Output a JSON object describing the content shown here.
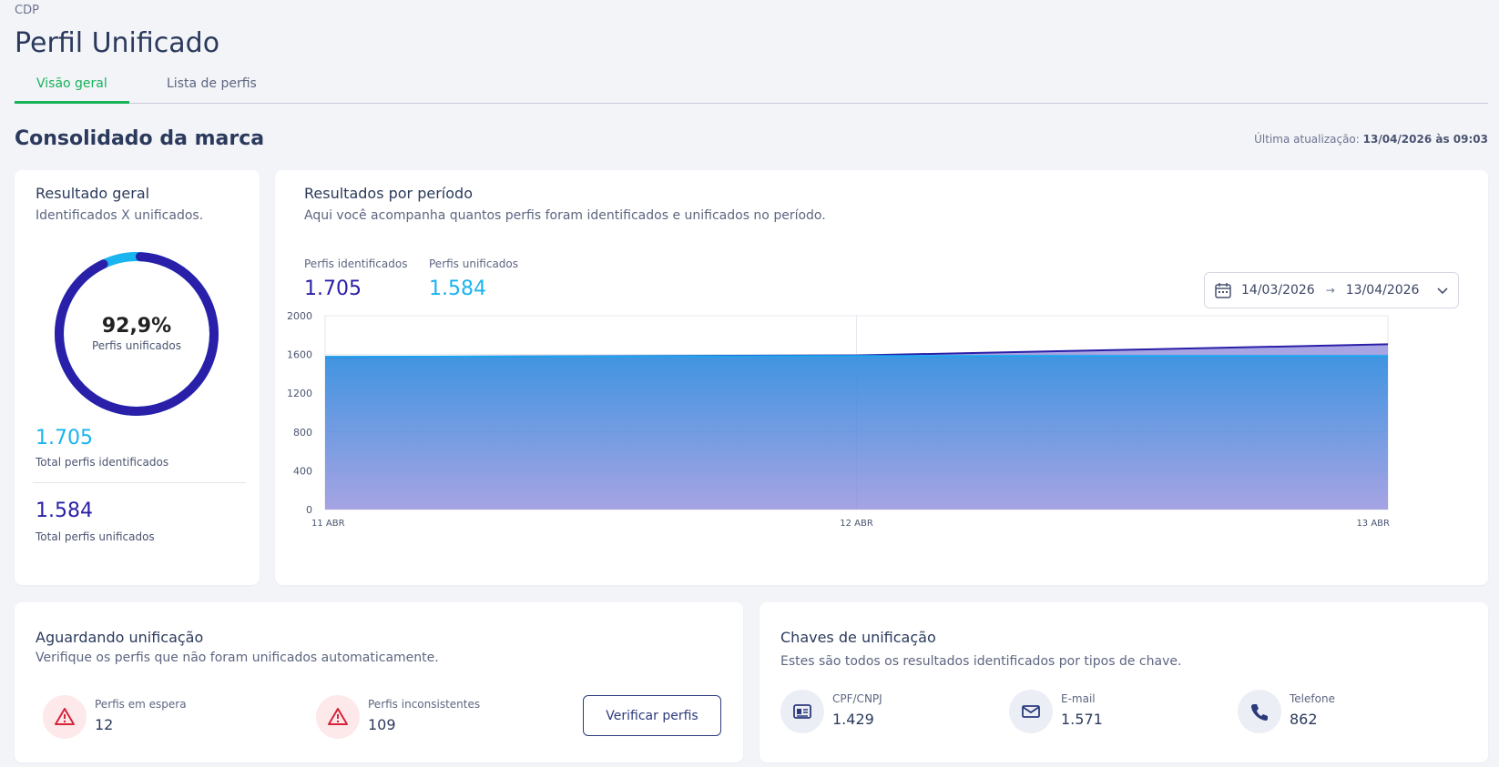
{
  "breadcrumb": "CDP",
  "page_title": "Perfil Unificado",
  "tabs": [
    {
      "label": "Visão geral",
      "active": true
    },
    {
      "label": "Lista de perfis",
      "active": false
    }
  ],
  "section_title": "Consolidado da marca",
  "last_update": {
    "label": "Última atualização: ",
    "value": "13/04/2026 às 09:03"
  },
  "overall": {
    "title": "Resultado geral",
    "subtitle": "Identificados X unificados.",
    "percent": "92,9%",
    "percent_label": "Perfis unificados",
    "percent_value": 0.929,
    "identified_value": "1.705",
    "identified_label": "Total perfis identificados",
    "unified_value": "1.584",
    "unified_label": "Total perfis unificados"
  },
  "period": {
    "title": "Resultados por período",
    "subtitle": "Aqui você acompanha quantos perfis foram identificados e unificados no período.",
    "identified_label": "Perfis identificados",
    "identified_value": "1.705",
    "unified_label": "Perfis unificados",
    "unified_value": "1.584",
    "date_from": "14/03/2026",
    "date_to": "13/04/2026"
  },
  "chart_data": {
    "type": "area",
    "x": [
      "11 ABR",
      "12 ABR",
      "13 ABR"
    ],
    "series": [
      {
        "name": "Perfis identificados",
        "values": [
          1575,
          1590,
          1705
        ],
        "color": "#2a1fa8"
      },
      {
        "name": "Perfis unificados",
        "values": [
          1575,
          1585,
          1584
        ],
        "color": "#1aa7ee"
      }
    ],
    "yticks": [
      "0",
      "400",
      "800",
      "1200",
      "1600",
      "2000"
    ],
    "ylim": [
      0,
      2000
    ],
    "grid": true
  },
  "pending": {
    "title": "Aguardando unificação",
    "subtitle": "Verifique os perfis que não foram unificados automaticamente.",
    "waiting_label": "Perfis em espera",
    "waiting_value": "12",
    "inconsistent_label": "Perfis inconsistentes",
    "inconsistent_value": "109",
    "verify_button": "Verificar perfis"
  },
  "keys": {
    "title": "Chaves de unificação",
    "subtitle": "Estes são todos os resultados identificados por tipos de chave.",
    "items": [
      {
        "label": "CPF/CNPJ",
        "value": "1.429",
        "icon": "id-card-icon"
      },
      {
        "label": "E-mail",
        "value": "1.571",
        "icon": "mail-icon"
      },
      {
        "label": "Telefone",
        "value": "862",
        "icon": "phone-icon"
      }
    ]
  },
  "colors": {
    "accent_green": "#16b35a",
    "identified_blue": "#2a1fa8",
    "unified_cyan": "#1ab4ee",
    "alert_red": "#d6243a"
  }
}
